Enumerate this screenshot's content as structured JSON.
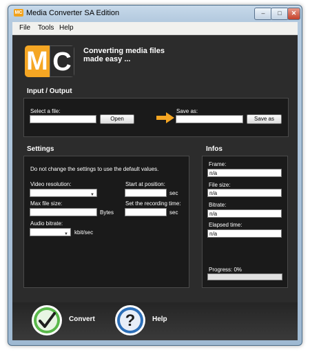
{
  "window": {
    "icon_text": "MC",
    "title": "Media Converter SA Edition",
    "min_glyph": "–",
    "max_glyph": "□",
    "close_glyph": "✕"
  },
  "menu": {
    "items": [
      {
        "label": "File"
      },
      {
        "label": "Tools"
      },
      {
        "label": "Help"
      }
    ]
  },
  "header": {
    "logo_letter_1": "M",
    "logo_letter_2": "C",
    "tagline_line1": "Converting media files",
    "tagline_line2": "made easy ..."
  },
  "io": {
    "section_title": "Input / Output",
    "select_label": "Select a file:",
    "select_value": "",
    "open_label": "Open",
    "arrow_icon": "arrow-right-icon",
    "save_label": "Save as:",
    "save_value": "",
    "save_button_label": "Save as"
  },
  "settings": {
    "section_title": "Settings",
    "note": "Do not change the settings to use the default values.",
    "video_resolution_label": "Video resolution:",
    "video_resolution_value": "",
    "max_file_size_label": "Max file size:",
    "max_file_size_value": "",
    "max_file_size_unit": "Bytes",
    "audio_bitrate_label": "Audio bitrate:",
    "audio_bitrate_value": "",
    "audio_bitrate_unit": "kbit/sec",
    "start_label": "Start at position:",
    "start_value": "",
    "start_unit": "sec",
    "record_label": "Set the recording time:",
    "record_value": "",
    "record_unit": "sec"
  },
  "infos": {
    "section_title": "Infos",
    "frame_label": "Frame:",
    "frame_value": "n/a",
    "file_size_label": "File size:",
    "file_size_value": "n/a",
    "bitrate_label": "Bitrate:",
    "bitrate_value": "n/a",
    "elapsed_label": "Elapsed time:",
    "elapsed_value": "n/a",
    "progress_label": "Progress: 0%",
    "progress_value": 0
  },
  "actions": {
    "convert_label": "Convert",
    "help_label": "Help",
    "convert_icon": "checkmark-icon",
    "help_icon": "question-mark-icon"
  },
  "colors": {
    "accent_orange": "#f5a623",
    "panel_bg": "#1a1a1a",
    "client_bg": "#2c2c2c",
    "convert_green": "#5ab84b",
    "help_blue": "#2d6fb8"
  }
}
